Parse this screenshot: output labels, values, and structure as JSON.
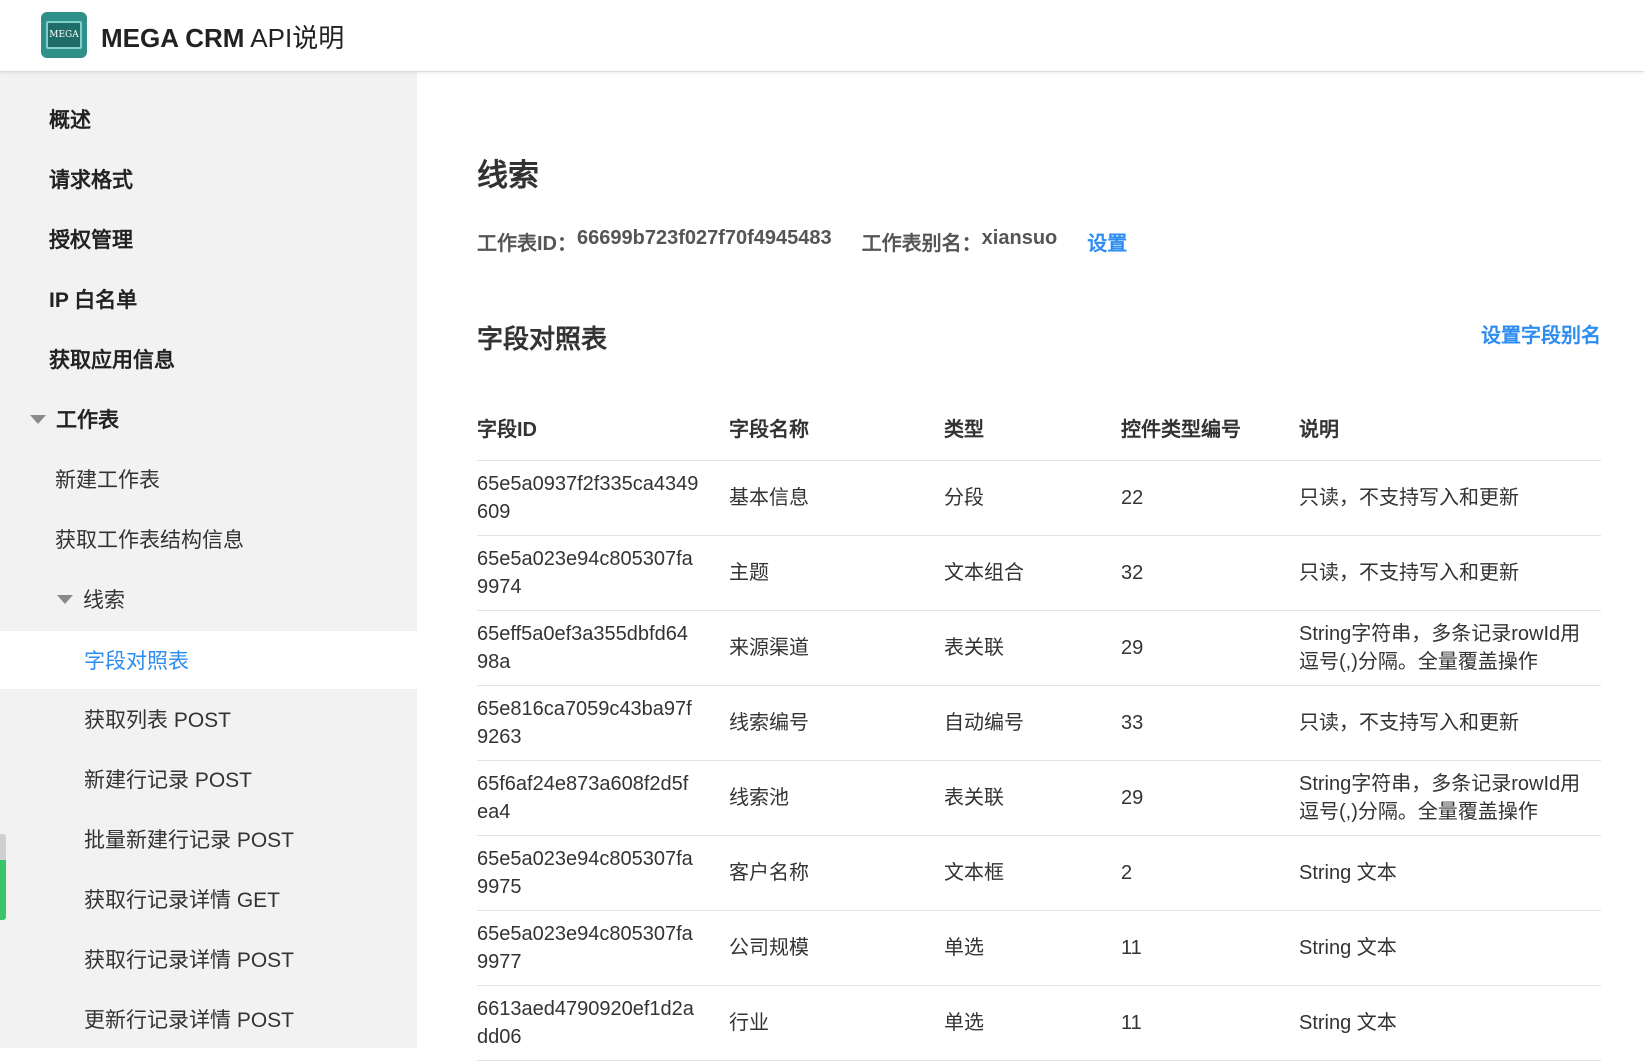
{
  "header": {
    "logo_text": "MEGA",
    "brand": "MEGA CRM",
    "subtitle": "API说明"
  },
  "sidebar": {
    "items": [
      {
        "label": "概述"
      },
      {
        "label": "请求格式"
      },
      {
        "label": "授权管理"
      },
      {
        "label": "IP 白名单"
      },
      {
        "label": "获取应用信息"
      },
      {
        "label": "工作表"
      },
      {
        "label": "新建工作表"
      },
      {
        "label": "获取工作表结构信息"
      },
      {
        "label": "线索"
      },
      {
        "label": "字段对照表"
      },
      {
        "label": "获取列表 POST"
      },
      {
        "label": "新建行记录 POST"
      },
      {
        "label": "批量新建行记录 POST"
      },
      {
        "label": "获取行记录详情 GET"
      },
      {
        "label": "获取行记录详情 POST"
      },
      {
        "label": "更新行记录详情 POST"
      }
    ]
  },
  "main": {
    "title": "线索",
    "worksheet_id_label": "工作表ID：",
    "worksheet_id": "66699b723f027f70f4945483",
    "alias_label": "工作表别名：",
    "alias": "xiansuo",
    "settings_link": "设置",
    "section_title": "字段对照表",
    "set_alias_link": "设置字段别名",
    "table": {
      "headers": [
        "字段ID",
        "字段名称",
        "类型",
        "控件类型编号",
        "说明"
      ],
      "rows": [
        [
          "65e5a0937f2f335ca4349609",
          "基本信息",
          "分段",
          "22",
          "只读，不支持写入和更新"
        ],
        [
          "65e5a023e94c805307fa9974",
          "主题",
          "文本组合",
          "32",
          "只读，不支持写入和更新"
        ],
        [
          "65eff5a0ef3a355dbfd6498a",
          "来源渠道",
          "表关联",
          "29",
          "String字符串，多条记录rowId用逗号(,)分隔。全量覆盖操作"
        ],
        [
          "65e816ca7059c43ba97f9263",
          "线索编号",
          "自动编号",
          "33",
          "只读，不支持写入和更新"
        ],
        [
          "65f6af24e873a608f2d5fea4",
          "线索池",
          "表关联",
          "29",
          "String字符串，多条记录rowId用逗号(,)分隔。全量覆盖操作"
        ],
        [
          "65e5a023e94c805307fa9975",
          "客户名称",
          "文本框",
          "2",
          "String 文本"
        ],
        [
          "65e5a023e94c805307fa9977",
          "公司规模",
          "单选",
          "11",
          "String 文本"
        ],
        [
          "6613aed4790920ef1d2add06",
          "行业",
          "单选",
          "11",
          "String 文本"
        ]
      ]
    }
  },
  "colors": {
    "accent": "#2d8cf0",
    "sidebar_bg": "#f2f2f2",
    "logo": "#2f8f89"
  }
}
